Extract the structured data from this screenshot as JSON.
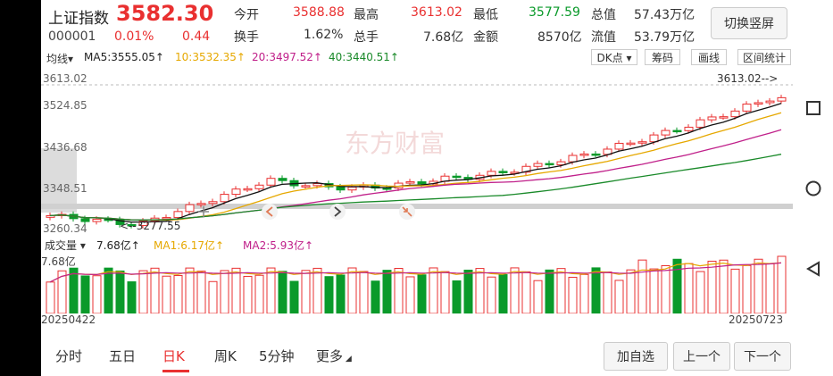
{
  "quote": {
    "name": "上证指数",
    "price": "3582.30",
    "code": "000001",
    "change_pct": "0.01%",
    "change": "0.44",
    "open_label": "今开",
    "open": "3588.88",
    "high_label": "最高",
    "high": "3613.02",
    "low_label": "最低",
    "low": "3577.59",
    "mktcap_label": "总值",
    "mktcap": "57.43万亿",
    "turnover_label": "换手",
    "turnover": "1.62%",
    "volume_label": "总手",
    "volume": "7.68亿",
    "amount_label": "金额",
    "amount": "8570亿",
    "float_label": "流值",
    "float": "53.79万亿",
    "toggle_label": "切换竖屏"
  },
  "ma_bar": {
    "type": "均线▾",
    "ma5": "MA5:3555.05↑",
    "ma10": "10:3532.35↑",
    "ma20": "20:3497.52↑",
    "ma40": "40:3440.51↑",
    "dk": "DK点 ▾",
    "chips": "筹码",
    "draw": "画线",
    "range_stat": "区间统计"
  },
  "chart_axis": {
    "y_labels": [
      "3613.02",
      "3524.85",
      "3436.68",
      "3348.51",
      "3260.34"
    ],
    "max_label": "3613.02-->",
    "min_label": "<--3277.55",
    "watermark": "东方财富"
  },
  "volume": {
    "label": "成交量 ▾",
    "vol": "7.68亿↑",
    "ma1": "MA1:6.17亿↑",
    "ma2": "MA2:5.93亿↑",
    "axis_max": "7.68亿"
  },
  "dates": {
    "start": "20250422",
    "end": "20250723"
  },
  "chart_data": {
    "type": "candlestick",
    "x_range": [
      "20250422",
      "20250723"
    ],
    "ylim": [
      3260.34,
      3613.02
    ],
    "y_ticks": [
      3613.02,
      3524.85,
      3436.68,
      3348.51,
      3260.34
    ],
    "high": 3613.02,
    "low": 3277.55,
    "last_close": 3582.3,
    "moving_averages": {
      "MA5": 3555.05,
      "MA10": 3532.35,
      "MA20": 3497.52,
      "MA40": 3440.51
    },
    "volume": {
      "last": "7.68亿",
      "MA1": "6.17亿",
      "MA2": "5.93亿"
    }
  },
  "tabs": {
    "items": [
      "分时",
      "五日",
      "日K",
      "周K",
      "5分钟",
      "更多"
    ],
    "active": "日K",
    "add_watch": "加自选",
    "prev": "上一个",
    "next": "下一个"
  },
  "colors": {
    "up": "#e93030",
    "down": "#0a9a2a",
    "ma5": "#111111",
    "ma10": "#e6a800",
    "ma20": "#c0208a",
    "ma40": "#1a8a2a"
  }
}
